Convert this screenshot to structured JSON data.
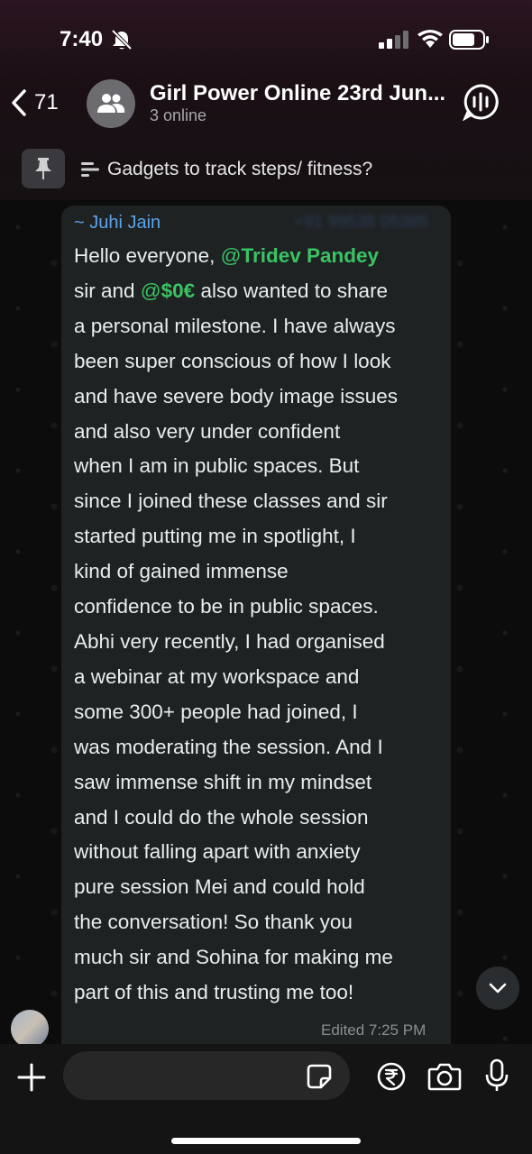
{
  "status_bar": {
    "time": "7:40"
  },
  "header": {
    "back_count": "71",
    "title": "Girl Power Online 23rd Jun...",
    "subtitle": "3 online"
  },
  "pinned": {
    "text": "Gadgets to track steps/ fitness?"
  },
  "message": {
    "sender": "~ Juhi Jain",
    "sender_phone": "+91 99538 05385",
    "lines": [
      {
        "pre": "Hello everyone, ",
        "mention_at": "@",
        "mention": "Tridev Pandey",
        "post": ""
      },
      {
        "pre": "sir and ",
        "mention_at": "@",
        "mention": "$0€",
        "post": " also wanted to share"
      },
      {
        "text": "a personal milestone. I have always"
      },
      {
        "text": "been super conscious of how I look"
      },
      {
        "text": "and have severe body image issues"
      },
      {
        "text": "and also very under confident"
      },
      {
        "text": "when I am in public spaces. But"
      },
      {
        "text": "since I joined these classes and sir"
      },
      {
        "text": "started putting me in spotlight, I"
      },
      {
        "text": "kind of gained immense"
      },
      {
        "text": "confidence to be in public spaces."
      },
      {
        "text": "Abhi very recently, I had organised"
      },
      {
        "text": "a webinar at my workspace and"
      },
      {
        "text": "some 300+ people had joined, I"
      },
      {
        "text": "was moderating the session. And I"
      },
      {
        "text": "saw immense shift in my mindset"
      },
      {
        "text": "and I could do the whole session"
      },
      {
        "text": "without falling apart with anxiety"
      },
      {
        "text": "pure session Mei and could hold"
      },
      {
        "text": "the conversation! So thank you"
      },
      {
        "text": "much sir and Sohina for making me"
      },
      {
        "text": "part of this and trusting me too!"
      }
    ],
    "edited_label": "Edited 7:25 PM"
  },
  "composer": {
    "placeholder": ""
  },
  "icons": {
    "bell": "bell-slash-icon",
    "signal": "cellular-signal-icon",
    "wifi": "wifi-icon",
    "battery": "battery-icon",
    "back": "chevron-left-icon",
    "avatar": "group-people-icon",
    "call": "voice-chat-icon",
    "pin": "pin-icon",
    "poll": "poll-icon",
    "scroll": "chevron-down-icon",
    "plus": "plus-icon",
    "sticker": "sticker-icon",
    "rupee": "rupee-payment-icon",
    "camera": "camera-icon",
    "mic": "microphone-icon"
  },
  "colors": {
    "mention": "#39c463",
    "sender": "#5ba3e8",
    "bubble": "#1f2223"
  }
}
